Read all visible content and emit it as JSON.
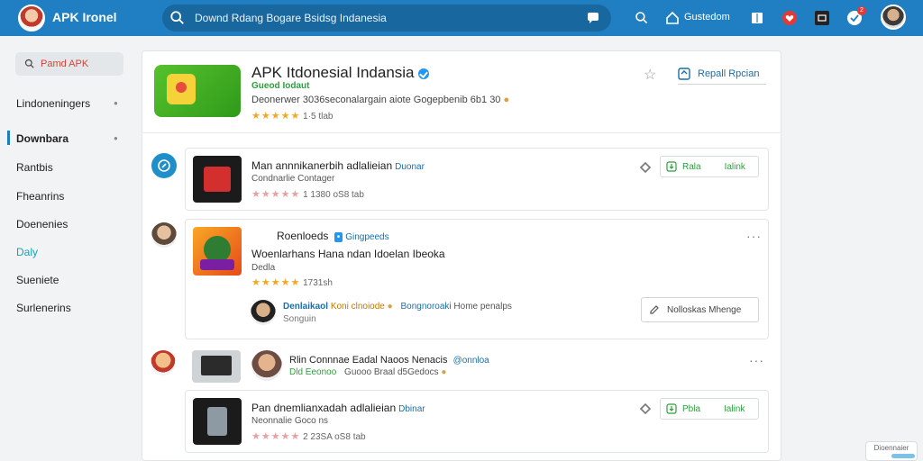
{
  "topbar": {
    "app_title": "APK Ironel",
    "search_placeholder": "Downd Rdang Bogare Bsidsg Indanesia",
    "nav_label": "Gustedom",
    "notification_count": "2"
  },
  "sidebar": {
    "search_label": "Pamd APK",
    "items": [
      {
        "label": "Lindoneningers"
      },
      {
        "label": "Downbara"
      },
      {
        "label": "Rantbis"
      },
      {
        "label": "Fheanrins"
      },
      {
        "label": "Doenenies"
      },
      {
        "label": "Daly"
      },
      {
        "label": "Sueniete"
      },
      {
        "label": "Surlenerins"
      }
    ]
  },
  "hero": {
    "title": "APK Itdonesial Indansia",
    "subtitle": "Gueod Iodaut",
    "description": "Deonerwer 3036seconalargain aiote Gogepbenib 6b1 30",
    "stars": "★★★★★",
    "rating": "1·5 tlab",
    "report_label": "Repall Rpcian"
  },
  "entries": [
    {
      "title": "Man annnikanerbih adlalieian",
      "tag": "Duonar",
      "subtitle": "Condnarlie Contager",
      "stars": "★★★★★",
      "rating": "1 1380 oS8 tab",
      "action_primary": "Rala",
      "action_secondary": "Ialink"
    },
    {
      "title": "Roenloeds",
      "tag": "Gingpeeds",
      "subtitle": "Woenlarhans Hana ndan Idoelan Ibeoka",
      "line2": "Dedla",
      "stars": "★★★★★",
      "rating": "1731sh",
      "commenter_name": "Denlaikaol",
      "commenter_tag": "Koni clnoiode",
      "commenter_extra": "Bongnoroaki",
      "commenter_extra2": "Home penalps",
      "commenter_sub": "Songuin",
      "button_label": "Nolloskas Mhenge"
    },
    {
      "title": "Rlin Connnae Eadal Naoos Nenacis",
      "tag": "@onnloa",
      "subtitle": "Dld Eeonoo",
      "line2": "Guooo Braal d5Gedocs"
    },
    {
      "title": "Pan dnemlianxadah adlalieian",
      "tag": "Dbinar",
      "subtitle": "Neonnalie Goco ns",
      "stars": "★★★★★",
      "rating": "2 23SA oS8 tab",
      "action_primary": "Pbla",
      "action_secondary": "Ialink"
    }
  ],
  "corner_label": "Dioennaier",
  "colors": {
    "brand": "#1f7fc2",
    "accent_green": "#2e9e3e",
    "link_blue": "#1a6ea8",
    "star": "#f5a623"
  }
}
